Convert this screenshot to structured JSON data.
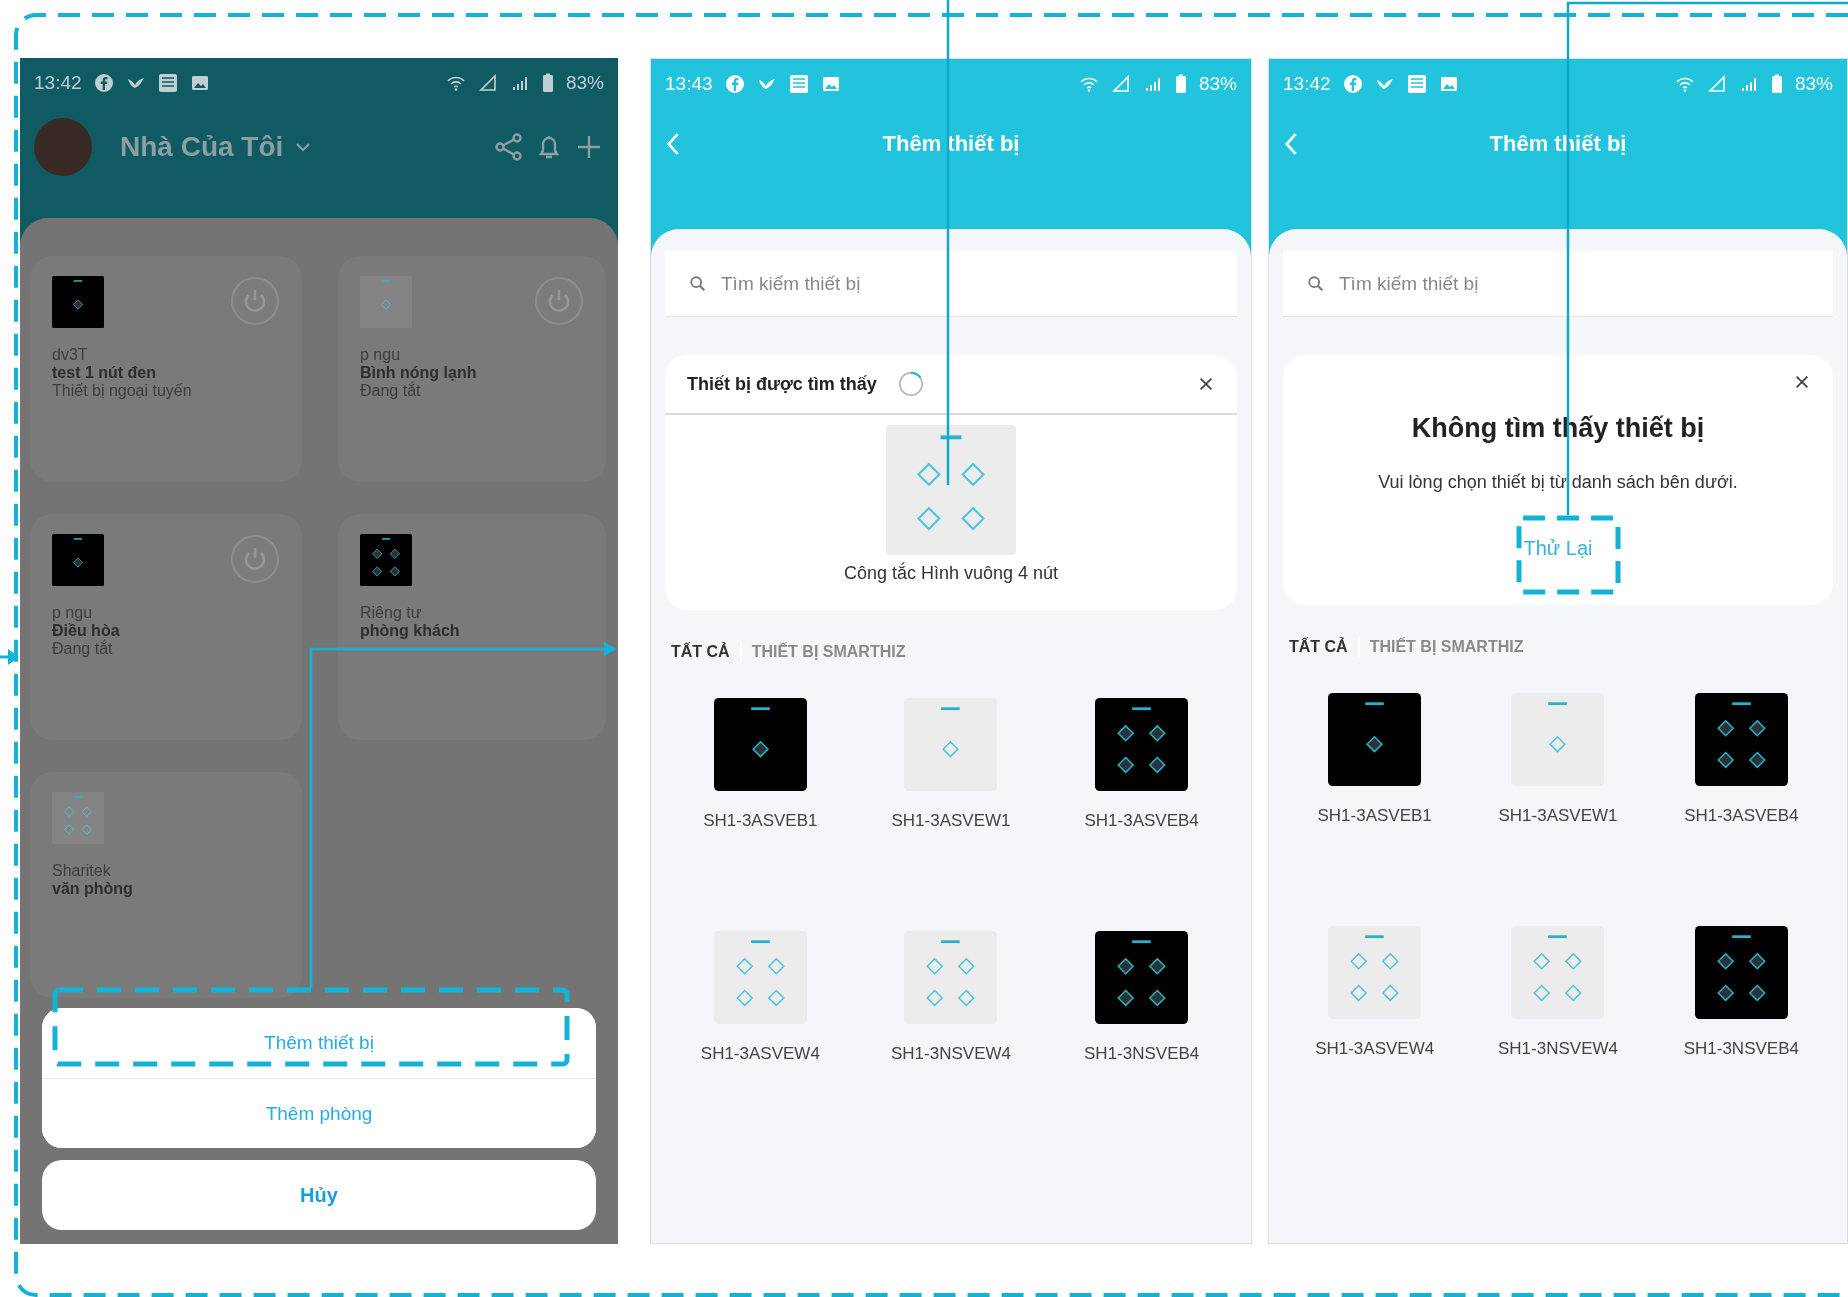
{
  "screens": [
    {
      "kind": "home",
      "status_bar": {
        "time": "13:42",
        "battery": "83%"
      },
      "header": {
        "title": "Nhà Của Tôi"
      },
      "devices": [
        {
          "room": "dv3T",
          "name": "test 1 nút đen",
          "status": "Thiết bị ngoại tuyến",
          "kind": "black_1",
          "power_button": true
        },
        {
          "room": "p ngu",
          "name": "Bình nóng lạnh",
          "status": "Đang tắt",
          "kind": "white_1",
          "power_button": true
        },
        {
          "room": "p ngu",
          "name": "Điều hòa",
          "status": "Đang tắt",
          "kind": "black_1",
          "power_button": true
        },
        {
          "room": "Riêng tư",
          "name": "phòng khách",
          "kind": "black_4",
          "power_button": false
        },
        {
          "room": "Sharitek",
          "name": "văn phòng",
          "kind": "white_4",
          "power_button": false
        }
      ],
      "action_sheet": {
        "items": [
          "Thêm thiết bị",
          "Thêm phòng"
        ],
        "cancel": "Hủy"
      }
    },
    {
      "kind": "add_device",
      "status_bar": {
        "time": "13:43",
        "battery": "83%"
      },
      "header": {
        "title": "Thêm thiết bị"
      },
      "search": {
        "placeholder": "Tìm kiếm thiết bị"
      },
      "result": {
        "kind": "found",
        "title": "Thiết bị được tìm thấy",
        "device": {
          "name": "Công tắc Hình vuông 4 nút",
          "kind": "white_4"
        }
      },
      "tabs": [
        {
          "label": "TẤT CẢ",
          "selected": true
        },
        {
          "label": "THIẾT BỊ SMARTHIZ",
          "selected": false
        }
      ],
      "catalog": [
        {
          "model": "SH1-3ASVEB1",
          "kind": "black_1"
        },
        {
          "model": "SH1-3ASVEW1",
          "kind": "white_1"
        },
        {
          "model": "SH1-3ASVEB4",
          "kind": "black_4"
        },
        {
          "model": "SH1-3ASVEW4",
          "kind": "white_4"
        },
        {
          "model": "SH1-3NSVEW4",
          "kind": "white_4"
        },
        {
          "model": "SH1-3NSVEB4",
          "kind": "black_4"
        }
      ]
    },
    {
      "kind": "add_device",
      "status_bar": {
        "time": "13:42",
        "battery": "83%"
      },
      "header": {
        "title": "Thêm thiết bị"
      },
      "search": {
        "placeholder": "Tìm kiếm thiết bị"
      },
      "result": {
        "kind": "not_found",
        "title": "Không tìm thấy thiết bị",
        "message": "Vui lòng chọn thiết bị từ danh sách bên dưới.",
        "retry": "Thử Lại"
      },
      "tabs": [
        {
          "label": "TẤT CẢ",
          "selected": true
        },
        {
          "label": "THIẾT BỊ SMARTHIZ",
          "selected": false
        }
      ],
      "catalog": [
        {
          "model": "SH1-3ASVEB1",
          "kind": "black_1"
        },
        {
          "model": "SH1-3ASVEW1",
          "kind": "white_1"
        },
        {
          "model": "SH1-3ASVEB4",
          "kind": "black_4"
        },
        {
          "model": "SH1-3ASVEW4",
          "kind": "white_4"
        },
        {
          "model": "SH1-3NSVEW4",
          "kind": "white_4"
        },
        {
          "model": "SH1-3NSVEB4",
          "kind": "black_4"
        }
      ]
    }
  ]
}
